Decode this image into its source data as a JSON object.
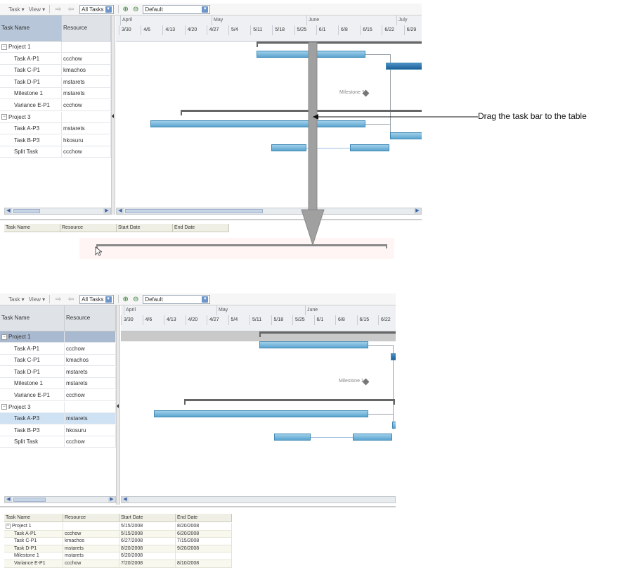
{
  "toolbar": {
    "task_menu": "Task ▾",
    "view_menu": "View ▾",
    "filter_value": "All Tasks",
    "zoom_in_icon": "zoom-in-icon",
    "zoom_out_icon": "zoom-out-icon",
    "scale_value": "Default"
  },
  "columns": {
    "task_name": "Task Name",
    "resource": "Resource"
  },
  "timeline": {
    "months": [
      "April",
      "May",
      "June",
      "July"
    ],
    "weeks": [
      "3/30",
      "4/6",
      "4/13",
      "4/20",
      "4/27",
      "5/4",
      "5/11",
      "5/18",
      "5/25",
      "6/1",
      "6/8",
      "6/15",
      "6/22",
      "6/29",
      "7/"
    ]
  },
  "tasks": [
    {
      "name": "Project 1",
      "resource": "",
      "group": true
    },
    {
      "name": "Task A-P1",
      "resource": "ccchow"
    },
    {
      "name": "Task C-P1",
      "resource": "kmachos"
    },
    {
      "name": "Task D-P1",
      "resource": "mstarets"
    },
    {
      "name": "Milestone 1",
      "resource": "mstarets"
    },
    {
      "name": "Variance E-P1",
      "resource": "ccchow"
    },
    {
      "name": "Project 3",
      "resource": "",
      "group": true
    },
    {
      "name": "Task A-P3",
      "resource": "mstarets"
    },
    {
      "name": "Task B-P3",
      "resource": "hkosuru"
    },
    {
      "name": "Split Task",
      "resource": "ccchow"
    }
  ],
  "milestone_label": "Milestone 1",
  "annotation": "Drag the task bar to the table",
  "bottom_table_top": {
    "headers": [
      "Task Name",
      "Resource",
      "Start Date",
      "End Date"
    ]
  },
  "bottom_table": {
    "headers": [
      "Task Name",
      "Resource",
      "Start Date",
      "End Date"
    ],
    "rows": [
      {
        "name": "Project 1",
        "resource": "",
        "start": "5/15/2008",
        "end": "8/20/2008",
        "group": true
      },
      {
        "name": "Task A-P1",
        "resource": "ccchow",
        "start": "5/15/2008",
        "end": "6/20/2008"
      },
      {
        "name": "Task C-P1",
        "resource": "kmachos",
        "start": "6/27/2008",
        "end": "7/15/2008"
      },
      {
        "name": "Task D-P1",
        "resource": "mstarets",
        "start": "8/20/2008",
        "end": "9/20/2008"
      },
      {
        "name": "Milestone 1",
        "resource": "mstarets",
        "start": "6/20/2008",
        "end": ""
      },
      {
        "name": "Variance E-P1",
        "resource": "ccchow",
        "start": "7/20/2008",
        "end": "8/10/2008"
      }
    ]
  },
  "colors": {
    "bar": "#5ca5cf",
    "selected_row": "#cfe2f4",
    "arrow": "#a0a0a0"
  }
}
